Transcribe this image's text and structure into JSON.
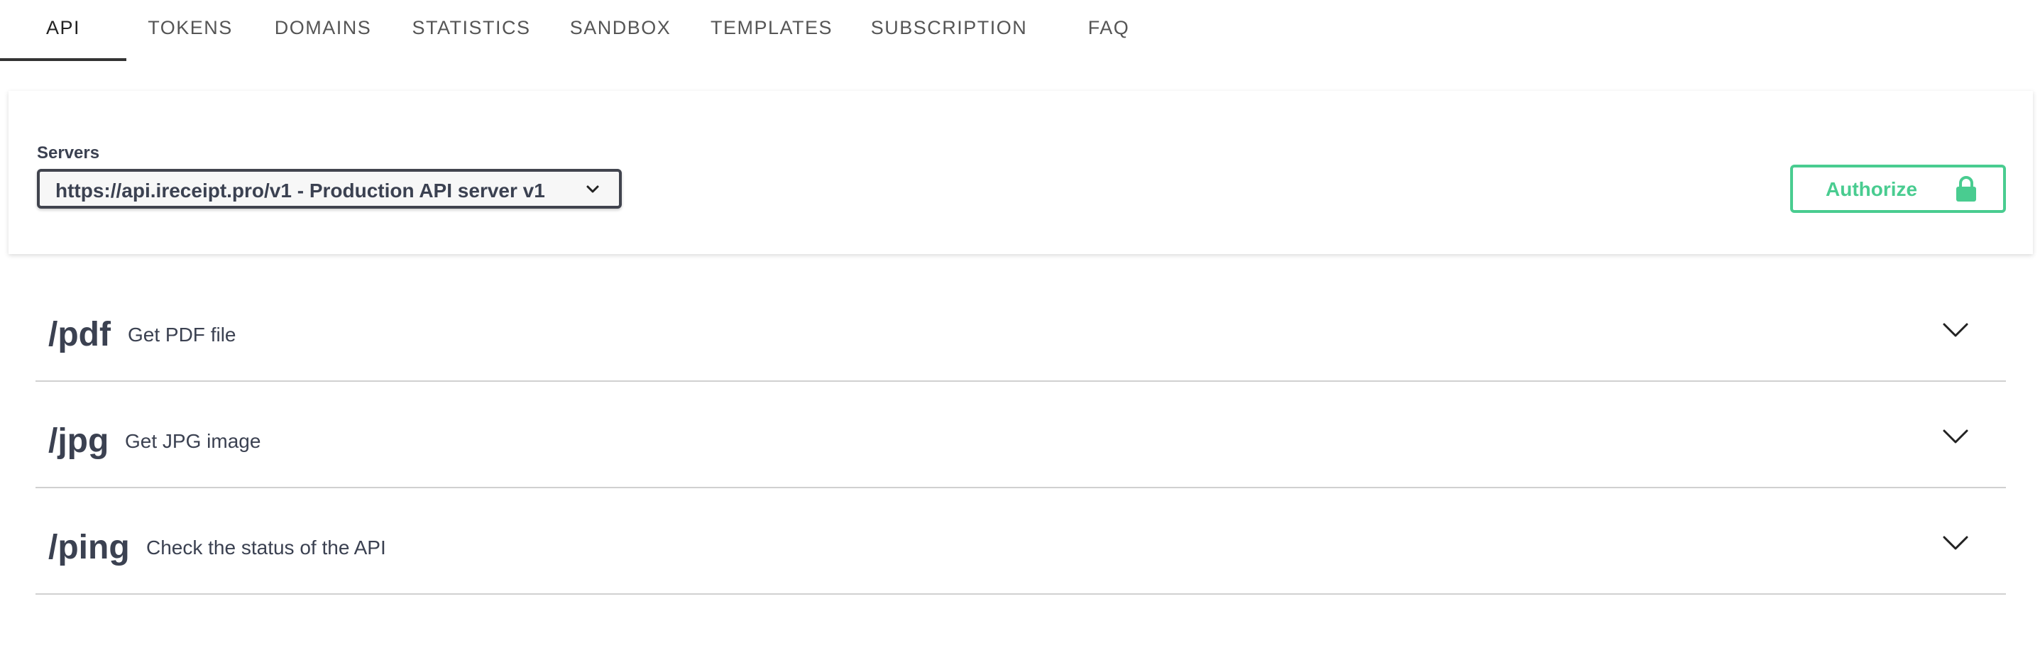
{
  "tabs": [
    {
      "label": "API"
    },
    {
      "label": "TOKENS"
    },
    {
      "label": "DOMAINS"
    },
    {
      "label": "STATISTICS"
    },
    {
      "label": "SANDBOX"
    },
    {
      "label": "TEMPLATES"
    },
    {
      "label": "SUBSCRIPTION"
    },
    {
      "label": "FAQ"
    }
  ],
  "active_tab": "API",
  "servers": {
    "label": "Servers",
    "selected": "https://api.ireceipt.pro/v1 - Production API server v1"
  },
  "authorize": {
    "label": "Authorize",
    "icon": "lock-icon",
    "color": "#49cc90"
  },
  "operations": [
    {
      "path": "/pdf",
      "description": "Get PDF file"
    },
    {
      "path": "/jpg",
      "description": "Get JPG image"
    },
    {
      "path": "/ping",
      "description": "Check the status of the API"
    }
  ]
}
